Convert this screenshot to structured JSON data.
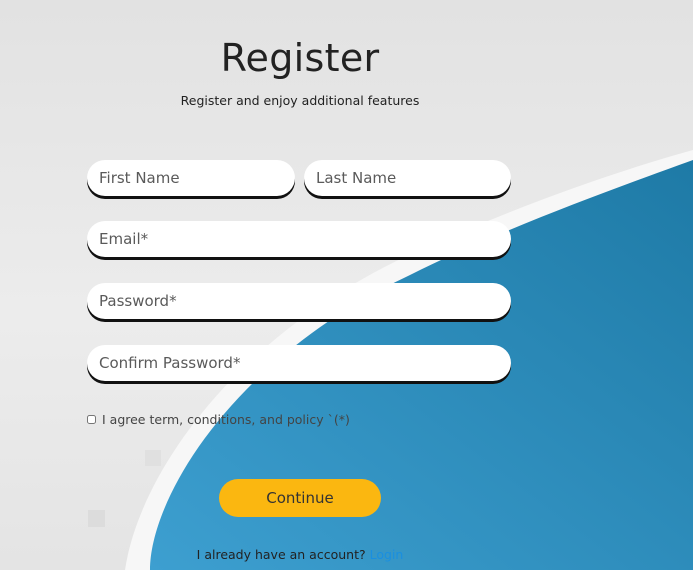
{
  "header": {
    "title": "Register",
    "subtitle": "Register and enjoy additional features"
  },
  "form": {
    "first_name_placeholder": "First Name",
    "last_name_placeholder": "Last Name",
    "email_placeholder": "Email*",
    "password_placeholder": "Password*",
    "confirm_password_placeholder": "Confirm Password*",
    "agree_label": "I agree term, conditions, and policy `(*)",
    "agree_checked": false,
    "continue_label": "Continue"
  },
  "footer": {
    "account_text": "I already have an account?",
    "login_label": "Login"
  },
  "colors": {
    "accent_button": "#fbb710",
    "link": "#1a8fe0",
    "background_shape": "#2b86b5"
  }
}
